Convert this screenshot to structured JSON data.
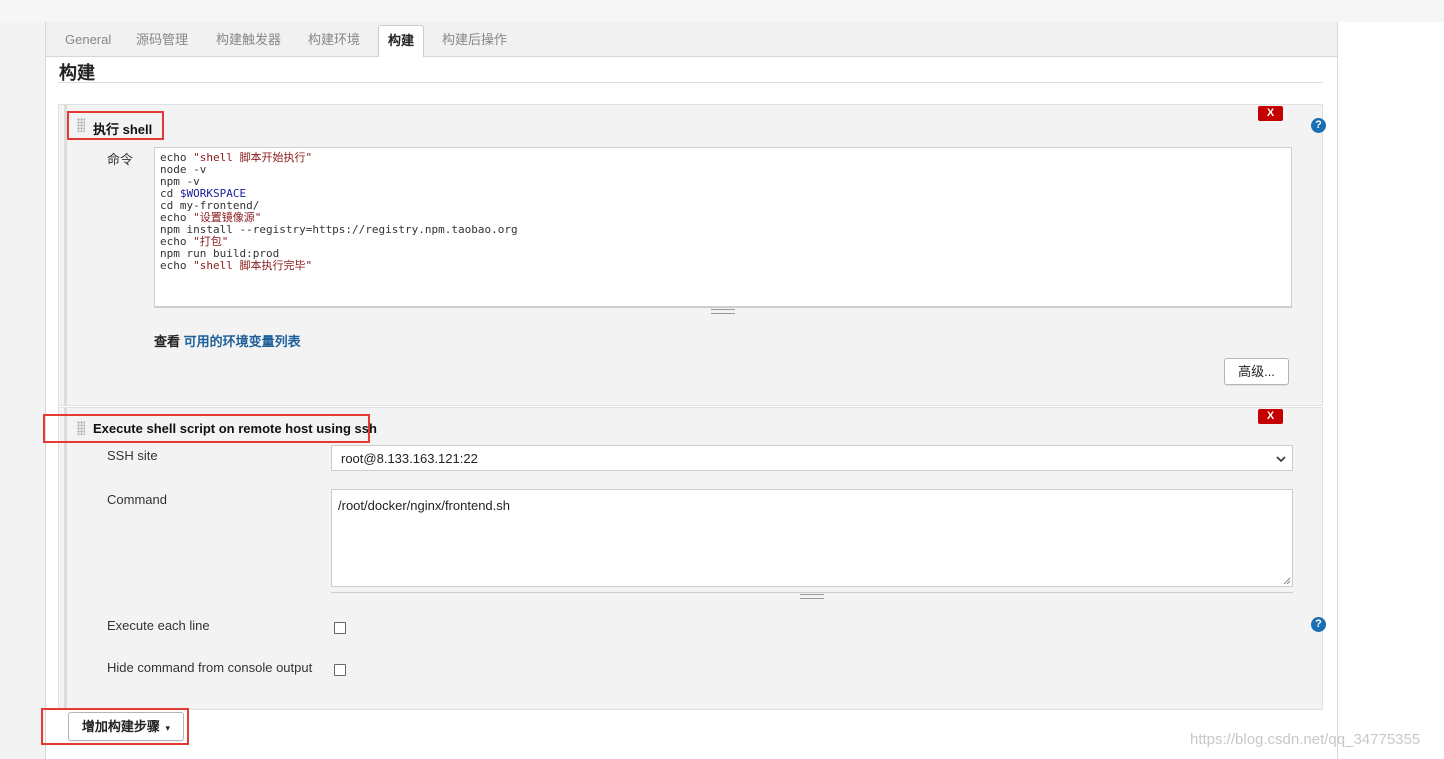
{
  "tabs": [
    {
      "label": "General"
    },
    {
      "label": "源码管理"
    },
    {
      "label": "构建触发器"
    },
    {
      "label": "构建环境"
    },
    {
      "label": "构建"
    },
    {
      "label": "构建后操作"
    }
  ],
  "active_tab": "构建",
  "section_title": "构建",
  "step1": {
    "title": "执行 shell",
    "delete_label": "X",
    "command_label": "命令",
    "code_lines": [
      "echo \"shell 脚本开始执行\"",
      "node -v",
      "npm -v",
      "cd $WORKSPACE",
      "cd my-frontend/",
      "echo \"设置镜像源\"",
      "npm install --registry=https://registry.npm.taobao.org",
      "echo \"打包\"",
      "npm run build:prod",
      "echo \"shell 脚本执行完毕\""
    ],
    "env_prefix": "查看",
    "env_link": "可用的环境变量列表",
    "advanced_button": "高级...",
    "help": "?"
  },
  "step2": {
    "title": "Execute shell script on remote host using ssh",
    "delete_label": "X",
    "ssh_site_label": "SSH site",
    "ssh_site_value": "root@8.133.163.121:22",
    "command_label": "Command",
    "command_value": "/root/docker/nginx/frontend.sh",
    "execute_each_line_label": "Execute each line",
    "execute_each_line_checked": false,
    "hide_command_label": "Hide command from console output",
    "hide_command_checked": false,
    "help": "?"
  },
  "add_step_button": "增加构建步骤",
  "watermark": "https://blog.csdn.net/qq_34775355",
  "colors": {
    "highlight_border": "#e53935",
    "delete_button": "#c40000",
    "link": "#1f5f99",
    "help_icon": "#1a6fb3"
  }
}
